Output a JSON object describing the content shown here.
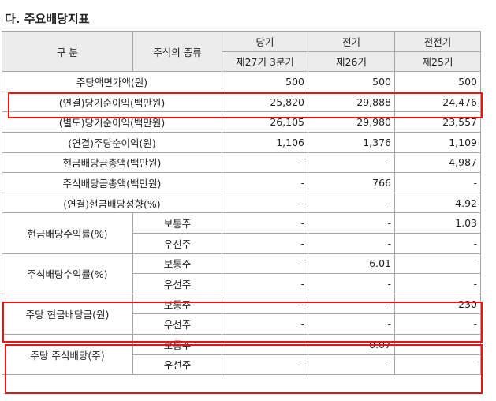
{
  "title": "다. 주요배당지표",
  "header": {
    "gubun": "구  분",
    "stock_type": "주식의 종류",
    "col1": "당기",
    "col2": "전기",
    "col3": "전전기",
    "col1_sub": "제27기 3분기",
    "col2_sub": "제26기",
    "col3_sub": "제25기"
  },
  "rows": [
    {
      "label": "주당액면가액(원)",
      "v": [
        "500",
        "500",
        "500"
      ]
    },
    {
      "label": "(연결)당기순이익(백만원)",
      "v": [
        "25,820",
        "29,888",
        "24,476"
      ]
    },
    {
      "label": "(별도)당기순이익(백만원)",
      "v": [
        "26,105",
        "29,980",
        "23,557"
      ]
    },
    {
      "label": "(연결)주당순이익(원)",
      "v": [
        "1,106",
        "1,376",
        "1,109"
      ]
    },
    {
      "label": "현금배당금총액(백만원)",
      "v": [
        "-",
        "-",
        "4,987"
      ]
    },
    {
      "label": "주식배당금총액(백만원)",
      "v": [
        "-",
        "766",
        "-"
      ]
    },
    {
      "label": "(연결)현금배당성향(%)",
      "v": [
        "-",
        "-",
        "4.92"
      ]
    }
  ],
  "groups": [
    {
      "label": "현금배당수익률(%)",
      "sub": [
        {
          "type": "보통주",
          "v": [
            "-",
            "-",
            "1.03"
          ]
        },
        {
          "type": "우선주",
          "v": [
            "-",
            "-",
            "-"
          ]
        }
      ]
    },
    {
      "label": "주식배당수익률(%)",
      "sub": [
        {
          "type": "보통주",
          "v": [
            "-",
            "6.01",
            "-"
          ]
        },
        {
          "type": "우선주",
          "v": [
            "-",
            "-",
            "-"
          ]
        }
      ]
    },
    {
      "label": "주당 현금배당금(원)",
      "sub": [
        {
          "type": "보통주",
          "v": [
            "-",
            "-",
            "230"
          ]
        },
        {
          "type": "우선주",
          "v": [
            "-",
            "-",
            "-"
          ]
        }
      ]
    },
    {
      "label": "주당 주식배당(주)",
      "sub": [
        {
          "type": "보통주",
          "v": [
            "-",
            "0.07",
            "-"
          ]
        },
        {
          "type": "우선주",
          "v": [
            "-",
            "-",
            "-"
          ]
        }
      ]
    }
  ],
  "highlight_color": "#ee1111"
}
